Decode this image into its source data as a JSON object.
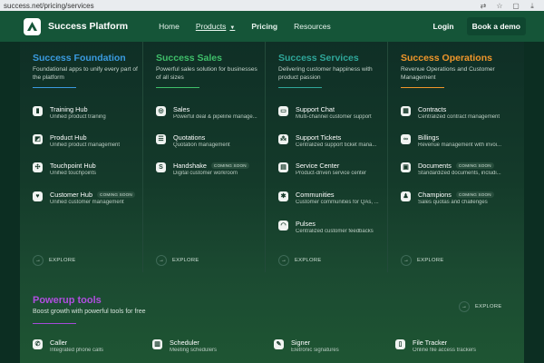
{
  "browser": {
    "url": "success.net/pricing/services"
  },
  "nav": {
    "brand": "Success Platform",
    "links": [
      "Home",
      "Products",
      "Pricing",
      "Resources"
    ],
    "login": "Login",
    "cta": "Book a demo"
  },
  "columns": [
    {
      "title": "Success Foundation",
      "subtitle": "Foundational apps to unify every part of the platform",
      "accent": "#3a9be0",
      "explore": "EXPLORE",
      "items": [
        {
          "icon": "book-icon",
          "glyph": "▮",
          "title": "Training Hub",
          "desc": "Unified product training",
          "badge": ""
        },
        {
          "icon": "product-icon",
          "glyph": "◩",
          "title": "Product Hub",
          "desc": "Unified product management",
          "badge": ""
        },
        {
          "icon": "touchpoint-icon",
          "glyph": "✣",
          "title": "Touchpoint Hub",
          "desc": "Unified touchpoints",
          "badge": ""
        },
        {
          "icon": "heart-icon",
          "glyph": "♥",
          "title": "Customer Hub",
          "desc": "Unified customer management",
          "badge": "COMING SOON"
        }
      ]
    },
    {
      "title": "Success Sales",
      "subtitle": "Powerful sales solution for businesses of all sizes",
      "accent": "#3fbf6a",
      "explore": "EXPLORE",
      "items": [
        {
          "icon": "target-icon",
          "glyph": "◎",
          "title": "Sales",
          "desc": "Powerful deal & pipeline manage...",
          "badge": ""
        },
        {
          "icon": "quote-icon",
          "glyph": "☰",
          "title": "Quotations",
          "desc": "Quotation management",
          "badge": ""
        },
        {
          "icon": "handshake-icon",
          "glyph": "S",
          "title": "Handshake",
          "desc": "Digital customer workroom",
          "badge": "COMING SOON"
        }
      ]
    },
    {
      "title": "Success Services",
      "subtitle": "Delivering customer happiness with product passion",
      "accent": "#2fa79a",
      "explore": "EXPLORE",
      "items": [
        {
          "icon": "chat-icon",
          "glyph": "▭",
          "title": "Support Chat",
          "desc": "Multi-channel customer support",
          "badge": ""
        },
        {
          "icon": "ticket-icon",
          "glyph": "⁂",
          "title": "Support Tickets",
          "desc": "Centralized support ticket mana...",
          "badge": ""
        },
        {
          "icon": "service-icon",
          "glyph": "▤",
          "title": "Service Center",
          "desc": "Product-driven service center",
          "badge": ""
        },
        {
          "icon": "community-icon",
          "glyph": "✱",
          "title": "Communities",
          "desc": "Customer communities for QAs, ...",
          "badge": ""
        },
        {
          "icon": "pulse-icon",
          "glyph": "◠",
          "title": "Pulses",
          "desc": "Centralized customer feedbacks",
          "badge": ""
        }
      ]
    },
    {
      "title": "Success Operations",
      "subtitle": "Revenue Operations and Customer Management",
      "accent": "#f0962a",
      "explore": "EXPLORE",
      "items": [
        {
          "icon": "contract-icon",
          "glyph": "▦",
          "title": "Contracts",
          "desc": "Centralized contract management",
          "badge": ""
        },
        {
          "icon": "billing-icon",
          "glyph": "∞",
          "title": "Billings",
          "desc": "Revenue management with invoi...",
          "badge": ""
        },
        {
          "icon": "document-icon",
          "glyph": "▣",
          "title": "Documents",
          "desc": "Standardized documents, includi...",
          "badge": "COMING SOON"
        },
        {
          "icon": "champion-icon",
          "glyph": "♟",
          "title": "Champions",
          "desc": "Sales quotas and challenges",
          "badge": "COMING SOON"
        }
      ]
    }
  ],
  "powerup": {
    "title": "Powerup tools",
    "subtitle": "Boost growth with powerful tools for free",
    "explore": "EXPLORE",
    "items": [
      {
        "icon": "phone-icon",
        "glyph": "✆",
        "title": "Caller",
        "desc": "Integrated phone calls"
      },
      {
        "icon": "calendar-icon",
        "glyph": "▥",
        "title": "Scheduler",
        "desc": "Meeting schedulers"
      },
      {
        "icon": "pen-icon",
        "glyph": "✎",
        "title": "Signer",
        "desc": "Eletronic signatures"
      },
      {
        "icon": "file-icon",
        "glyph": "▯",
        "title": "File Tracker",
        "desc": "Online file access trackers"
      }
    ]
  }
}
